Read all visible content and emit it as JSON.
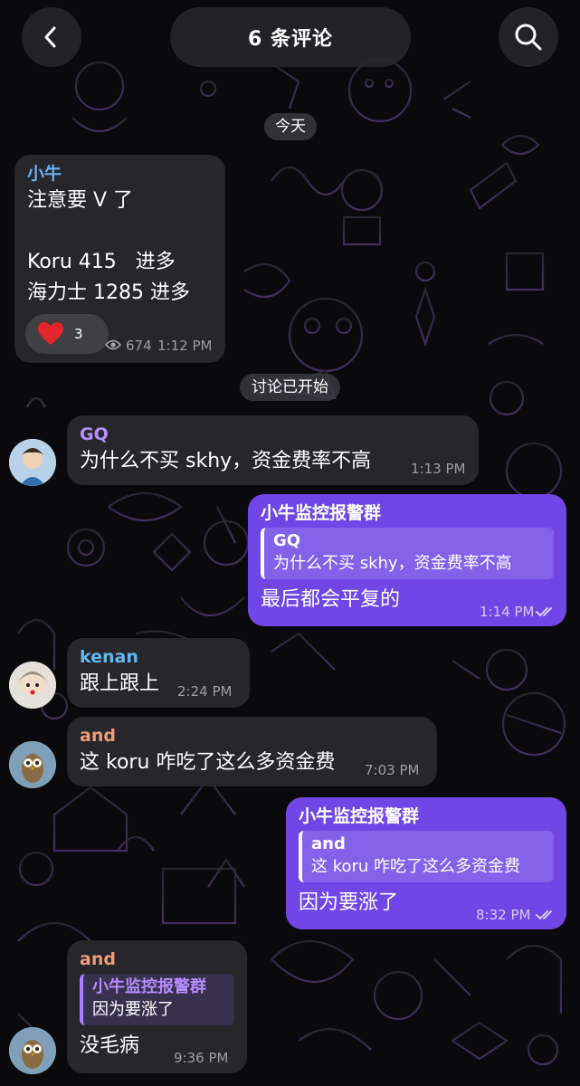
{
  "header": {
    "title": "6 条评论",
    "back_icon": "chevron-left-icon",
    "search_icon": "search-icon"
  },
  "date_chip": "今天",
  "discussion_chip": "讨论已开始",
  "colors": {
    "outgoing_bubble": "#7047e6",
    "incoming_bubble": "#28282e",
    "name_xiaoniu": "#6ab0f0",
    "name_gq": "#b890ff",
    "name_kenan": "#62b8ee",
    "name_and": "#f09a7a"
  },
  "messages": {
    "channel_post": {
      "sender": "小牛",
      "lines": [
        "注意要 V 了",
        "",
        "Koru 415   进多",
        "海力士 1285 进多"
      ],
      "reaction_icon": "heart-icon",
      "reaction_count": "3",
      "views_icon": "eye-icon",
      "views": "674",
      "time": "1:12 PM"
    },
    "gq": {
      "sender": "GQ",
      "text": "为什么不买 skhy，资金费率不高",
      "time": "1:13 PM"
    },
    "reply1": {
      "sender": "小牛监控报警群",
      "quote_name": "GQ",
      "quote_text": "为什么不买 skhy，资金费率不高",
      "text": "最后都会平复的",
      "time": "1:14 PM"
    },
    "kenan": {
      "sender": "kenan",
      "text": "跟上跟上",
      "time": "2:24 PM"
    },
    "and1": {
      "sender": "and",
      "text": "这 koru 咋吃了这么多资金费",
      "time": "7:03 PM"
    },
    "reply2": {
      "sender": "小牛监控报警群",
      "quote_name": "and",
      "quote_text": "这 koru 咋吃了这么多资金费",
      "text": "因为要涨了",
      "time": "8:32 PM"
    },
    "and2": {
      "sender": "and",
      "quote_name": "小牛监控报警群",
      "quote_text": "因为要涨了",
      "text": "没毛病",
      "time": "9:36 PM"
    }
  }
}
